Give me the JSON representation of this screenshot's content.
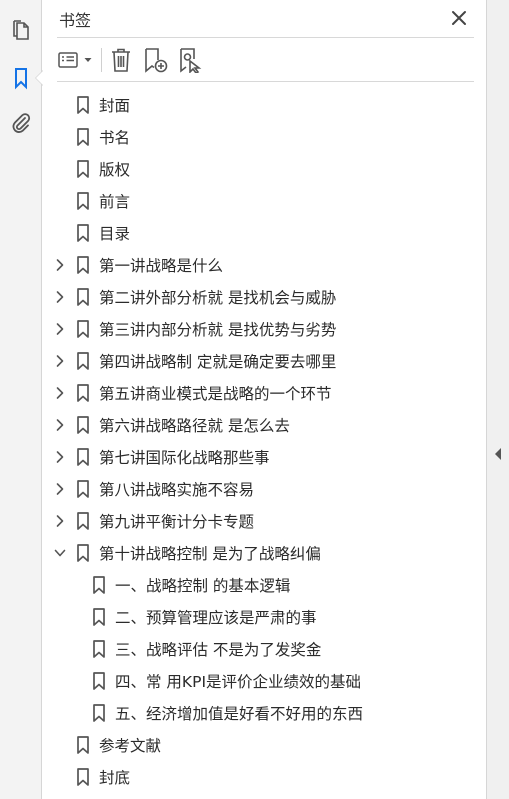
{
  "rail": {
    "items": [
      {
        "name": "pages-icon",
        "active": false
      },
      {
        "name": "bookmark-icon",
        "active": true
      },
      {
        "name": "attachment-icon",
        "active": false
      }
    ]
  },
  "panel": {
    "title": "书签",
    "close_icon": "close-icon"
  },
  "toolbar": {
    "buttons": [
      "options-menu-icon",
      "delete-icon",
      "new-bookmark-icon",
      "bookmark-from-selection-icon"
    ]
  },
  "colors": {
    "accent": "#1473e6",
    "icon": "#555555",
    "text": "#2b2b2b"
  },
  "bookmarks": [
    {
      "label": "封面",
      "level": 0,
      "expandable": false,
      "expanded": false
    },
    {
      "label": "书名",
      "level": 0,
      "expandable": false,
      "expanded": false
    },
    {
      "label": "版权",
      "level": 0,
      "expandable": false,
      "expanded": false
    },
    {
      "label": "前言",
      "level": 0,
      "expandable": false,
      "expanded": false
    },
    {
      "label": "目录",
      "level": 0,
      "expandable": false,
      "expanded": false
    },
    {
      "label": "第一讲战略是什么",
      "level": 0,
      "expandable": true,
      "expanded": false
    },
    {
      "label": "第二讲外部分析就 是找机会与威胁",
      "level": 0,
      "expandable": true,
      "expanded": false
    },
    {
      "label": "第三讲内部分析就 是找优势与劣势",
      "level": 0,
      "expandable": true,
      "expanded": false
    },
    {
      "label": "第四讲战略制 定就是确定要去哪里",
      "level": 0,
      "expandable": true,
      "expanded": false
    },
    {
      "label": "第五讲商业模式是战略的一个环节",
      "level": 0,
      "expandable": true,
      "expanded": false
    },
    {
      "label": "第六讲战略路径就 是怎么去",
      "level": 0,
      "expandable": true,
      "expanded": false
    },
    {
      "label": "第七讲国际化战略那些事",
      "level": 0,
      "expandable": true,
      "expanded": false
    },
    {
      "label": "第八讲战略实施不容易",
      "level": 0,
      "expandable": true,
      "expanded": false
    },
    {
      "label": "第九讲平衡计分卡专题",
      "level": 0,
      "expandable": true,
      "expanded": false
    },
    {
      "label": "第十讲战略控制 是为了战略纠偏",
      "level": 0,
      "expandable": true,
      "expanded": true
    },
    {
      "label": "一、战略控制 的基本逻辑",
      "level": 1,
      "expandable": false,
      "expanded": false
    },
    {
      "label": "二、预算管理应该是严肃的事",
      "level": 1,
      "expandable": false,
      "expanded": false
    },
    {
      "label": "三、战略评估 不是为了发奖金",
      "level": 1,
      "expandable": false,
      "expanded": false
    },
    {
      "label": "四、常 用KPI是评价企业绩效的基础",
      "level": 1,
      "expandable": false,
      "expanded": false
    },
    {
      "label": "五、经济增加值是好看不好用的东西",
      "level": 1,
      "expandable": false,
      "expanded": false
    },
    {
      "label": "参考文献",
      "level": 0,
      "expandable": false,
      "expanded": false
    },
    {
      "label": "封底",
      "level": 0,
      "expandable": false,
      "expanded": false
    }
  ]
}
